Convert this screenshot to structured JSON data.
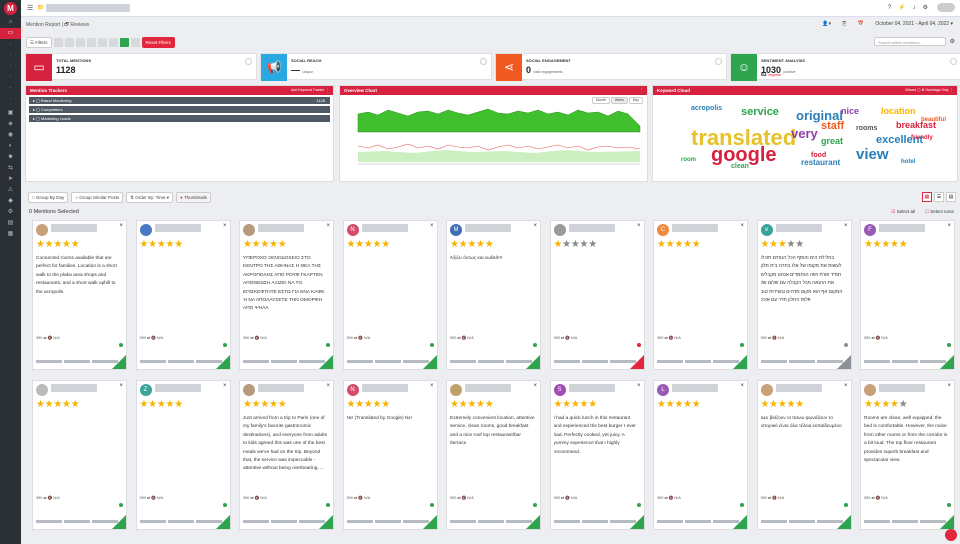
{
  "sidebar": {
    "logo": "M"
  },
  "topbar": {
    "fold_label": "📁 ▸"
  },
  "breadcrumb": "Mention Report | 🗗 Reviews",
  "toolbar": {
    "date_range": "October 04, 2021 - April 04, 2022"
  },
  "filters": {
    "label": "Filters",
    "reset_label": "Reset Filters"
  },
  "search": {
    "placeholder": "Search within mentions..."
  },
  "stats": [
    {
      "title": "TOTAL MENTIONS",
      "value": "1128",
      "sub": "",
      "color": "#d6213f",
      "icon": "chat-icon"
    },
    {
      "title": "SOCIAL REACH",
      "value": "—",
      "sub": "unique",
      "color": "#29a9e0",
      "icon": "megaphone-icon"
    },
    {
      "title": "SOCIAL ENGAGEMENT",
      "value": "0",
      "sub": "total engagements",
      "color": "#f05a22",
      "icon": "share-icon"
    },
    {
      "title": "SENTIMENT ANALYSIS",
      "value": "1030",
      "sub": "positive",
      "value2": "63",
      "sub2": "negative",
      "color": "#2ea44f",
      "icon": "smiley-icon"
    }
  ],
  "trackers": {
    "title": "Mention Trackers",
    "add_label": "Add Keyword Tracker",
    "rows": [
      {
        "label": "Brand Monitoring",
        "count": "1128"
      },
      {
        "label": "Competitors",
        "count": ""
      },
      {
        "label": "Marketing Leads",
        "count": ""
      }
    ]
  },
  "overview": {
    "title": "Overview Chart",
    "tabs": [
      "Month",
      "Week",
      "Day"
    ]
  },
  "cloud": {
    "title": "Keyword Cloud",
    "wizard_label": "Wizard",
    "hashtags_label": "Hashtags Only",
    "words": [
      {
        "t": "translated",
        "c": "#e6c229"
      },
      {
        "t": "google",
        "c": "#d6213f"
      },
      {
        "t": "original",
        "c": "#2a7fb8"
      },
      {
        "t": "very",
        "c": "#8c3fa8"
      },
      {
        "t": "view",
        "c": "#2a7fb8"
      },
      {
        "t": "service",
        "c": "#2ea44f"
      },
      {
        "t": "staff",
        "c": "#f05a22"
      },
      {
        "t": "excellent",
        "c": "#2a7fb8"
      },
      {
        "t": "breakfast",
        "c": "#d6213f"
      },
      {
        "t": "location",
        "c": "#f5b400"
      },
      {
        "t": "great",
        "c": "#2ea44f"
      },
      {
        "t": "restaurant",
        "c": "#2a7fb8"
      },
      {
        "t": "nice",
        "c": "#8c3fa8"
      },
      {
        "t": "acropolis",
        "c": "#2a7fb8"
      },
      {
        "t": "rooms",
        "c": "#555555"
      },
      {
        "t": "friendly",
        "c": "#d6213f"
      },
      {
        "t": "beautiful",
        "c": "#f05a22"
      },
      {
        "t": "clean",
        "c": "#2ea44f"
      },
      {
        "t": "hotel",
        "c": "#2a7fb8"
      },
      {
        "t": "food",
        "c": "#d6213f"
      },
      {
        "t": "room",
        "c": "#2ea44f"
      }
    ]
  },
  "group": {
    "by_day": "Group By Day",
    "similar": "Group Similar Posts",
    "order": "Order By: Time ▾",
    "thumbs": "Thumbnails"
  },
  "selection": {
    "count": "0 Mentions Selected",
    "select_all": "Select all",
    "select_none": "Select none"
  },
  "cards": [
    {
      "av": "",
      "avc": "#c8a07a",
      "stars": 5,
      "text": "Connected rooms available that are perfect for families. Location is a short walk to the plaka area shops and restaurants, and a short walk uphill to the acropolis.",
      "foot": "390 ⇄ 🔇 N/A",
      "corner": "green"
    },
    {
      "av": "",
      "avc": "#4a78c2",
      "stars": 5,
      "text": "",
      "foot": "390 ⇄ 🔇 N/A",
      "corner": "green"
    },
    {
      "av": "",
      "avc": "#b59a7c",
      "stars": 5,
      "text": "ΥΠΕΡΟΧΟ ΞΕΝΟΔΟΧΕΙΟ ΣΤΟ ΚΕΝΤΡΟ ΤΗΣ ΑΘΗΝΑΣ Η ΘΕΑ ΤΗΣ ΑΚΡΟΠΟΛΗΣ ΑΠΟ ΡΟΥΦ ΓΚΑΡΤΕΝ ΑΠΟΘΕΩΣΗ ΑΞΙΖΕΙ ΝΑ ΤΟ ΕΠΙΣΚΕΦΤΗΤΕ ΕΣΤΩ ΓΙΑ ΕΝΑ ΚΑΦΕ Ή ΝΑ ΑΠΟΛΑΥΣΕΤΕ ΤΗΝ ΟΜΟΡΦΗ ΑΠΟ ΨΗΛΑ",
      "foot": "390 ⇄ 🔇 N/A",
      "corner": "green"
    },
    {
      "av": "N",
      "avc": "#d64b6a",
      "stars": 5,
      "text": "",
      "foot": "390 ⇄ 🔇 N/A",
      "corner": "green"
    },
    {
      "av": "M",
      "avc": "#3f6fb5",
      "stars": 5,
      "text": "Άξιζει όντως και νωθεί!!!!",
      "foot": "390 ⇄ 🔇 N/A",
      "corner": "green"
    },
    {
      "av": "",
      "avc": "#9a9a9a",
      "stars": 1,
      "text": "",
      "foot": "390 ⇄ 🔇 N/A",
      "corner": "red"
    },
    {
      "av": "C",
      "avc": "#f0883e",
      "stars": 5,
      "text": "",
      "foot": "390 ⇄ 🔇 N/A",
      "corner": "green"
    },
    {
      "av": "ע",
      "avc": "#3aa39a",
      "stars": 3,
      "text": "בחלילת הים והוסף הכל הנוחים תוכלו לעשות את מקומו של אלו בחרנו בית מלון תמיד פורח ויפה הנחמדים אנחנו מקבלים את ההנאה מכל הקבלה עם שלום של המקום אף הוא מקום מדהים ובשירות טוב פלוס החלון חדר עם אוכל",
      "foot": "390 ⇄ 🔇 N/A",
      "corner": "gray"
    },
    {
      "av": "F",
      "avc": "#9b59b6",
      "stars": 5,
      "text": "",
      "foot": "390 ⇄ 🔇 N/A",
      "corner": "green"
    },
    {
      "av": "",
      "avc": "#bbbbbb",
      "stars": 5,
      "text": "",
      "foot": "390 ⇄ 🔇 N/A",
      "corner": "green"
    },
    {
      "av": "Z",
      "avc": "#3aa39a",
      "stars": 5,
      "text": "",
      "foot": "390 ⇄ 🔇 N/A",
      "corner": "green"
    },
    {
      "av": "",
      "avc": "#b59a7c",
      "stars": 5,
      "text": "Just arrived from a trip to Paris (one of my family's favorite gastronomic destinations), and everyone from adults to kids agreed this was one of the best meals we've had on the trip. Beyond that, the service was impeccable - attentive without being overbearing, ...",
      "foot": "390 ⇄ 🔇 N/A",
      "corner": "green"
    },
    {
      "av": "N",
      "avc": "#d64b6a",
      "stars": 5,
      "text": "Nε! (Translated by Google) Nε!",
      "foot": "390 ⇄ 🔇 N/A",
      "corner": "green"
    },
    {
      "av": "",
      "avc": "#c0a16b",
      "stars": 5,
      "text": "Extremely convenient location, attentive service, clean rooms, good breakfast and a nice roof top restaurant/bar /terrace",
      "foot": "390 ⇄ 🔇 N/A",
      "corner": "green"
    },
    {
      "av": "S",
      "avc": "#a24ab5",
      "stars": 5,
      "text": "I had a quick lunch in this restaurant and experienced the best burger I ever had. Perfectly cooked, yet juicy. A yummy experience that I highly recommend.",
      "foot": "390 ⇄ 🔇 N/A",
      "corner": "green"
    },
    {
      "av": "L",
      "avc": "#9b59b6",
      "stars": 5,
      "text": "",
      "foot": "390 ⇄ 🔇 N/A",
      "corner": "green"
    },
    {
      "av": "",
      "avc": "#c8a07a",
      "stars": 5,
      "text": "Δεν βιάζουν οι πανω φωνάζουν το ιστορικό είναι όλα τέλεια εκπαιδευμένο",
      "foot": "390 ⇄ 🔇 N/A",
      "corner": "green"
    },
    {
      "av": "",
      "avc": "#c8a07a",
      "stars": 4,
      "text": "Rooms are clean, well equipped, the bed is comfortable. However, the noise from other rooms or from the corridor is a bit loud. The top floor restaurant provides superb breakfast and spectacular view.",
      "foot": "390 ⇄ 🔇 N/A",
      "corner": "green"
    }
  ]
}
